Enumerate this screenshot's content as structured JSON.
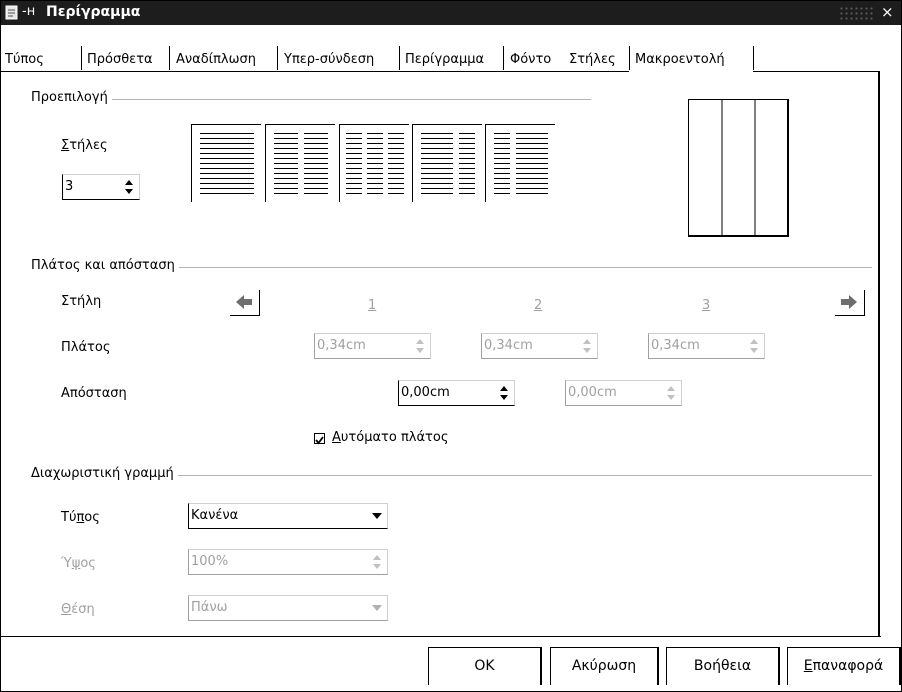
{
  "window": {
    "title": "Περίγραμμα",
    "close_glyph": "×",
    "pin_glyph": "-н",
    "icon": "document-icon"
  },
  "tabs": [
    "Τύπος",
    "Πρόσθετα",
    "Αναδίπλωση",
    "Υπερ-σύνδεση",
    "Περίγραμμα",
    "Φόντο",
    "Στήλες",
    "Μακροεντολή"
  ],
  "active_tab": "Στήλες",
  "preset": {
    "section_title": "Προεπιλογή",
    "columns_label_prefix": "",
    "columns_label_accel": "Σ",
    "columns_label_rest": "τήλες",
    "columns_value": "3",
    "preset_icons": [
      "one-column",
      "two-columns",
      "three-columns",
      "two-columns-left-wide",
      "two-columns-right-wide"
    ],
    "preview_columns": 3
  },
  "width_spacing": {
    "section_title": "Πλάτος και απόσταση",
    "column_label": "Στήλη",
    "width_label": "Πλάτος",
    "spacing_label": "Απόσταση",
    "column_numbers": [
      "1",
      "2",
      "3"
    ],
    "widths": [
      "0,34cm",
      "0,34cm",
      "0,34cm"
    ],
    "spacings": [
      "0,00cm",
      "0,00cm"
    ],
    "auto_width_accel": "Α",
    "auto_width_rest": "υτόματο πλάτος",
    "auto_width_checked": true
  },
  "separator": {
    "section_title": "Διαχωριστική γραμμή",
    "type_label_pre": "Τύ",
    "type_label_accel": "π",
    "type_label_post": "ος",
    "type_value": "Κανένα",
    "height_label_pre": "Ύ",
    "height_label_accel": "ψ",
    "height_label_post": "ος",
    "height_value": "100%",
    "position_label_accel": "Θ",
    "position_label_rest": "έση",
    "position_value": "Πάνω"
  },
  "buttons": {
    "ok": "OK",
    "cancel": "Ακύρωση",
    "help": "Βοήθεια",
    "reset_accel": "Ε",
    "reset_rest": "παναφορά"
  },
  "colors": {
    "titlebar": "#1d1d1d",
    "disabled_text": "#a0a0a0",
    "section_line": "#b4b4b4"
  }
}
